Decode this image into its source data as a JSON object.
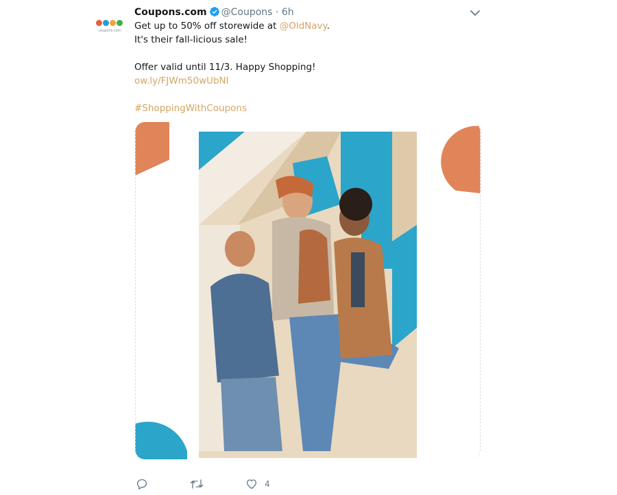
{
  "tweet": {
    "author": {
      "name": "Coupons.com",
      "handle": "@Coupons",
      "separator": "·",
      "time": "6h",
      "avatar_text": "coupons.com",
      "avatar_dot_colors": [
        "#e85c3c",
        "#2a9bd3",
        "#f2a33a",
        "#3cb04a"
      ],
      "verified_color": "#1da1f2"
    },
    "text": {
      "line1_prefix": "Get up to 50% off storewide at ",
      "mention": "@OldNavy",
      "line1_suffix": ".",
      "line2": "It's their fall-licious sale!",
      "line4": "Offer valid until 11/3. Happy Shopping!",
      "link": "ow.ly/FJWm50wUbNI",
      "hashtag": "#ShoppingWithCoupons"
    },
    "colors": {
      "link": "#d4a463",
      "accent_orange": "#e0855a",
      "accent_blue": "#2ba5c9"
    },
    "actions": {
      "reply_icon": "reply-icon",
      "retweet_icon": "retweet-icon",
      "like_icon": "heart-icon",
      "like_count": "4"
    }
  }
}
